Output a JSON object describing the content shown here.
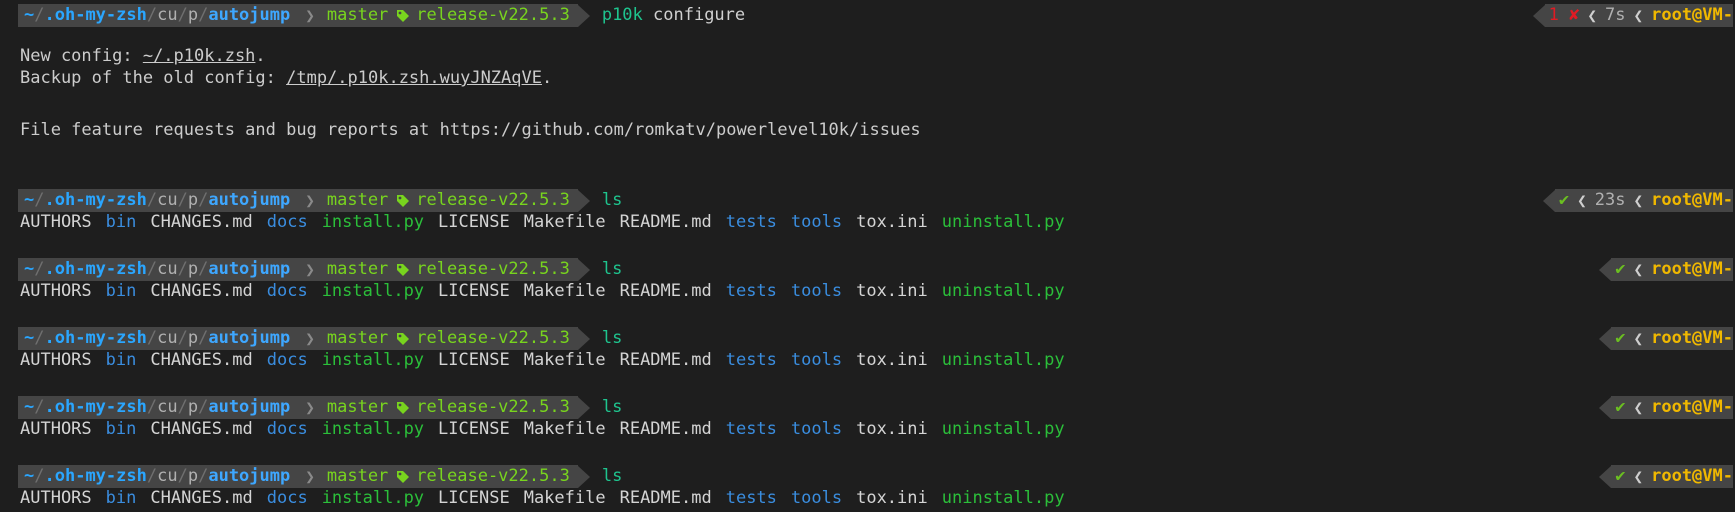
{
  "prompt": {
    "path": {
      "home": "~",
      "sep": "/",
      "part1": ".oh-my-zsh",
      "part2": "cu",
      "part3": "p",
      "current": "autojump"
    },
    "git": {
      "branch": "master",
      "tag": "release-v22.5.3"
    },
    "right": {
      "user": "root@VM-"
    }
  },
  "commands": [
    {
      "name": "p10k",
      "rest": " configure",
      "right_status": "1 ✘",
      "right_time": "7s"
    },
    {
      "name": "ls",
      "rest": "",
      "right_status": "✔",
      "right_time": "23s"
    },
    {
      "name": "ls",
      "rest": "",
      "right_status": "✔",
      "right_time": ""
    },
    {
      "name": "ls",
      "rest": "",
      "right_status": "✔",
      "right_time": ""
    },
    {
      "name": "ls",
      "rest": "",
      "right_status": "✔",
      "right_time": ""
    },
    {
      "name": "ls",
      "rest": "",
      "right_status": "✔",
      "right_time": ""
    }
  ],
  "configure_output": {
    "new_config_label": "New config: ",
    "new_config_path": "~/.p10k.zsh",
    "backup_label": "Backup of the old config: ",
    "backup_path": "/tmp/.p10k.zsh.wuyJNZAqVE",
    "period": ".",
    "issues_line": "File feature requests and bug reports at https://github.com/romkatv/powerlevel10k/issues"
  },
  "ls_output": [
    {
      "name": "AUTHORS",
      "kind": "plain"
    },
    {
      "name": "bin",
      "kind": "dir"
    },
    {
      "name": "CHANGES.md",
      "kind": "plain"
    },
    {
      "name": "docs",
      "kind": "dir"
    },
    {
      "name": "install.py",
      "kind": "exe"
    },
    {
      "name": "LICENSE",
      "kind": "plain"
    },
    {
      "name": "Makefile",
      "kind": "plain"
    },
    {
      "name": "README.md",
      "kind": "plain"
    },
    {
      "name": "tests",
      "kind": "dir"
    },
    {
      "name": "tools",
      "kind": "dir"
    },
    {
      "name": "tox.ini",
      "kind": "plain"
    },
    {
      "name": "uninstall.py",
      "kind": "exe"
    }
  ],
  "colors": {
    "background": "#1e1e1e",
    "segment": "#454545",
    "path_blue": "#2aa6ff",
    "git_green": "#78d41e",
    "command": "#1ec48e",
    "error": "#e01b24",
    "ok": "#6bbf21",
    "user_yellow": "#f0b800",
    "dir_blue": "#3a8ddf",
    "exe_green": "#2bbf3a"
  },
  "icons": {
    "tag": "tag-icon",
    "status_ok": "check-icon",
    "status_err": "cross-icon",
    "separator": "chevron-right-icon"
  }
}
